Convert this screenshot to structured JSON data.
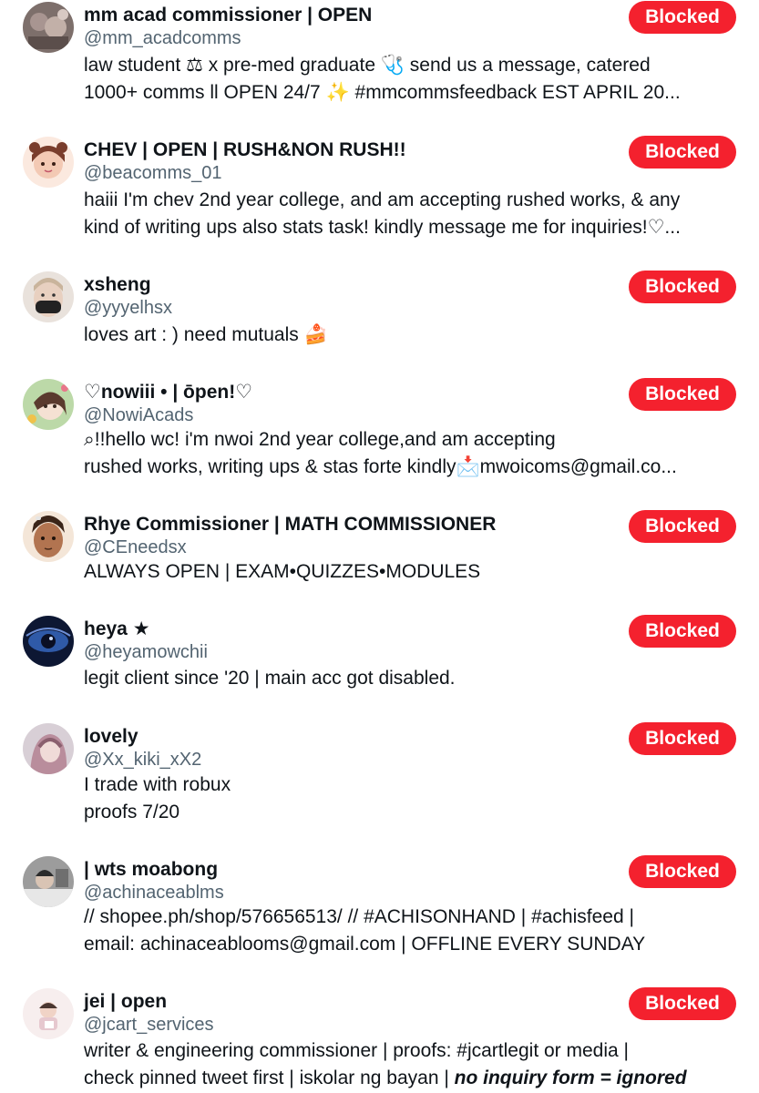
{
  "blocked_label": "Blocked",
  "accounts": [
    {
      "name": "mm acad commissioner | OPEN",
      "handle": "@mm_acadcomms",
      "bio_lines": [
        "law student ⚖ x pre-med graduate 🩺 send us a message, catered",
        "1000+ comms ll OPEN 24/7 ✨ #mmcommsfeedback EST APRIL 20..."
      ],
      "avatar_color": "#8b7d78"
    },
    {
      "name": "CHEV | OPEN | RUSH&NON RUSH!!",
      "handle": "@beacomms_01",
      "bio_lines": [
        "haiii I'm chev 2nd year college, and am accepting rushed works, & any",
        "kind of writing ups also stats task! kindly message me for inquiries!♡..."
      ],
      "avatar_color": "#f3d6c8"
    },
    {
      "name": "xsheng",
      "handle": "@yyyelhsx",
      "bio_lines": [
        "loves art : ) need mutuals 🍰"
      ],
      "avatar_color": "#d9cdc4"
    },
    {
      "name": "♡nowiii • | ōpen!♡",
      "handle": "@NowiAcads",
      "bio_lines": [
        "⌕!!hello wc! i'm nwoi 2nd year college,and am accepting",
        "rushed works, writing ups & stas forte kindly📩mwoicoms@gmail.co..."
      ],
      "avatar_color": "#a9c99a"
    },
    {
      "name": "Rhye Commissioner | MATH COMMISSIONER",
      "handle": "@CEneedsx",
      "bio_lines": [
        "ALWAYS OPEN | EXAM•QUIZZES•MODULES"
      ],
      "avatar_color": "#b77a55"
    },
    {
      "name": "heya ★",
      "handle": "@heyamowchii",
      "bio_lines": [
        "legit client since '20 | main acc got disabled."
      ],
      "avatar_color": "#1b2a55"
    },
    {
      "name": "lovely",
      "handle": "@Xx_kiki_xX2",
      "bio_lines": [
        "I trade with robux",
        "proofs 7/20"
      ],
      "avatar_color": "#c9a6b4"
    },
    {
      "name": "| wts moabong",
      "handle": "@achinaceablms",
      "bio_lines": [
        "// shopee.ph/shop/576656513/ // #ACHISONHAND | #achisfeed |",
        "email: achinaceablooms@gmail.com | OFFLINE EVERY SUNDAY"
      ],
      "avatar_color": "#8f8f8f"
    },
    {
      "name": "jei | open",
      "handle": "@jcart_services",
      "bio_lines": [
        "writer & engineering commissioner | proofs: #jcartlegit or media |",
        "check pinned tweet first | iskolar ng bayan | "
      ],
      "bio_emphasis": "no inquiry form = ignored",
      "avatar_color": "#f2e6e6"
    }
  ]
}
